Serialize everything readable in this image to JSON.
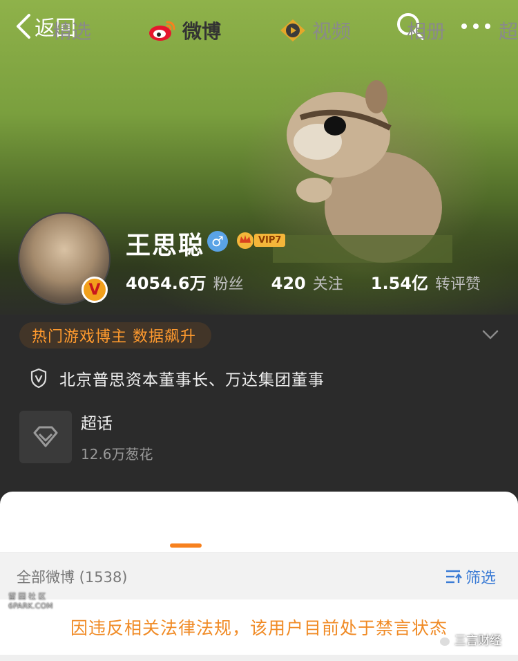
{
  "nav": {
    "back_label": "返回"
  },
  "profile": {
    "name": "王思聪",
    "gender_symbol": "♂",
    "verified_badge": "V",
    "vip_label": "VIP7",
    "stats": [
      {
        "value": "4054.6万",
        "label": "粉丝"
      },
      {
        "value": "420",
        "label": "关注"
      },
      {
        "value": "1.54亿",
        "label": "转评赞"
      }
    ],
    "hot_tag": "热门游戏博主 数据飙升",
    "certification": "北京普思资本董事长、万达集团董事"
  },
  "super_topic": {
    "title": "超话",
    "subtitle": "12.6万葱花"
  },
  "tabs": [
    {
      "label": "精选"
    },
    {
      "label": "微博"
    },
    {
      "label": "视频"
    },
    {
      "label": "相册"
    },
    {
      "label": "超"
    }
  ],
  "feed": {
    "title": "全部微博 (1538)",
    "filter_label": "筛选",
    "notice": "因违反相关法律法规，该用户目前处于禁言状态"
  },
  "watermarks": {
    "left_line1": "留 园 社 区",
    "left_line2": "6PARK.COM",
    "right": "三言财经"
  },
  "colors": {
    "accent_orange": "#f7811e",
    "notice_orange": "#f08a24",
    "filter_blue": "#3a7bd5",
    "vip_gold": "#f4b63a"
  },
  "icons": [
    "chevron-left-icon",
    "search-icon",
    "more-dots-icon",
    "gender-male-icon",
    "vip-crown-icon",
    "chevron-down-icon",
    "shield-v-icon",
    "diamond-icon",
    "weibo-icon",
    "video-icon",
    "filter-icon"
  ]
}
